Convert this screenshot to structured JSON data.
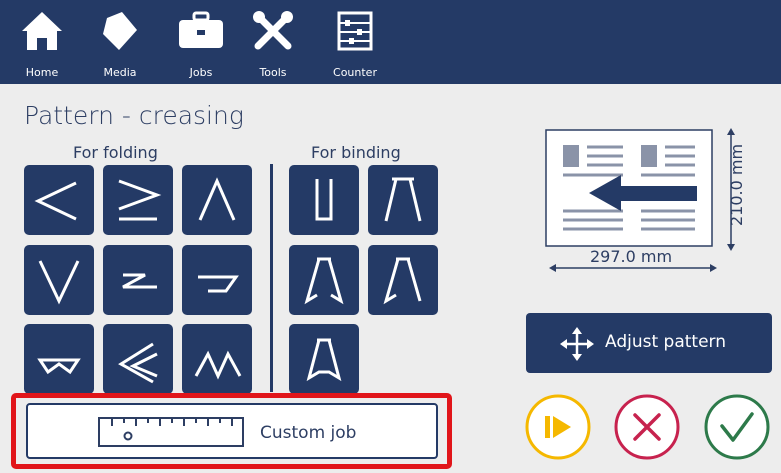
{
  "nav": {
    "items": [
      {
        "label": "Home",
        "icon": "home-icon"
      },
      {
        "label": "Media",
        "icon": "media-icon"
      },
      {
        "label": "Jobs",
        "icon": "briefcase-icon"
      },
      {
        "label": "Tools",
        "icon": "tools-icon"
      },
      {
        "label": "Counter",
        "icon": "abacus-icon"
      }
    ]
  },
  "page": {
    "title": "Pattern - creasing",
    "folding_label": "For folding",
    "binding_label": "For binding"
  },
  "preview": {
    "width_label": "297.0 mm",
    "height_label": "210.0 mm"
  },
  "actions": {
    "adjust_label": "Adjust pattern",
    "custom_job_label": "Custom job"
  },
  "colors": {
    "navy": "#243a66",
    "text": "#2d3e63",
    "highlight": "#e1151a",
    "play": "#f5b800",
    "cancel": "#c7224e",
    "confirm": "#2d7a4a"
  }
}
